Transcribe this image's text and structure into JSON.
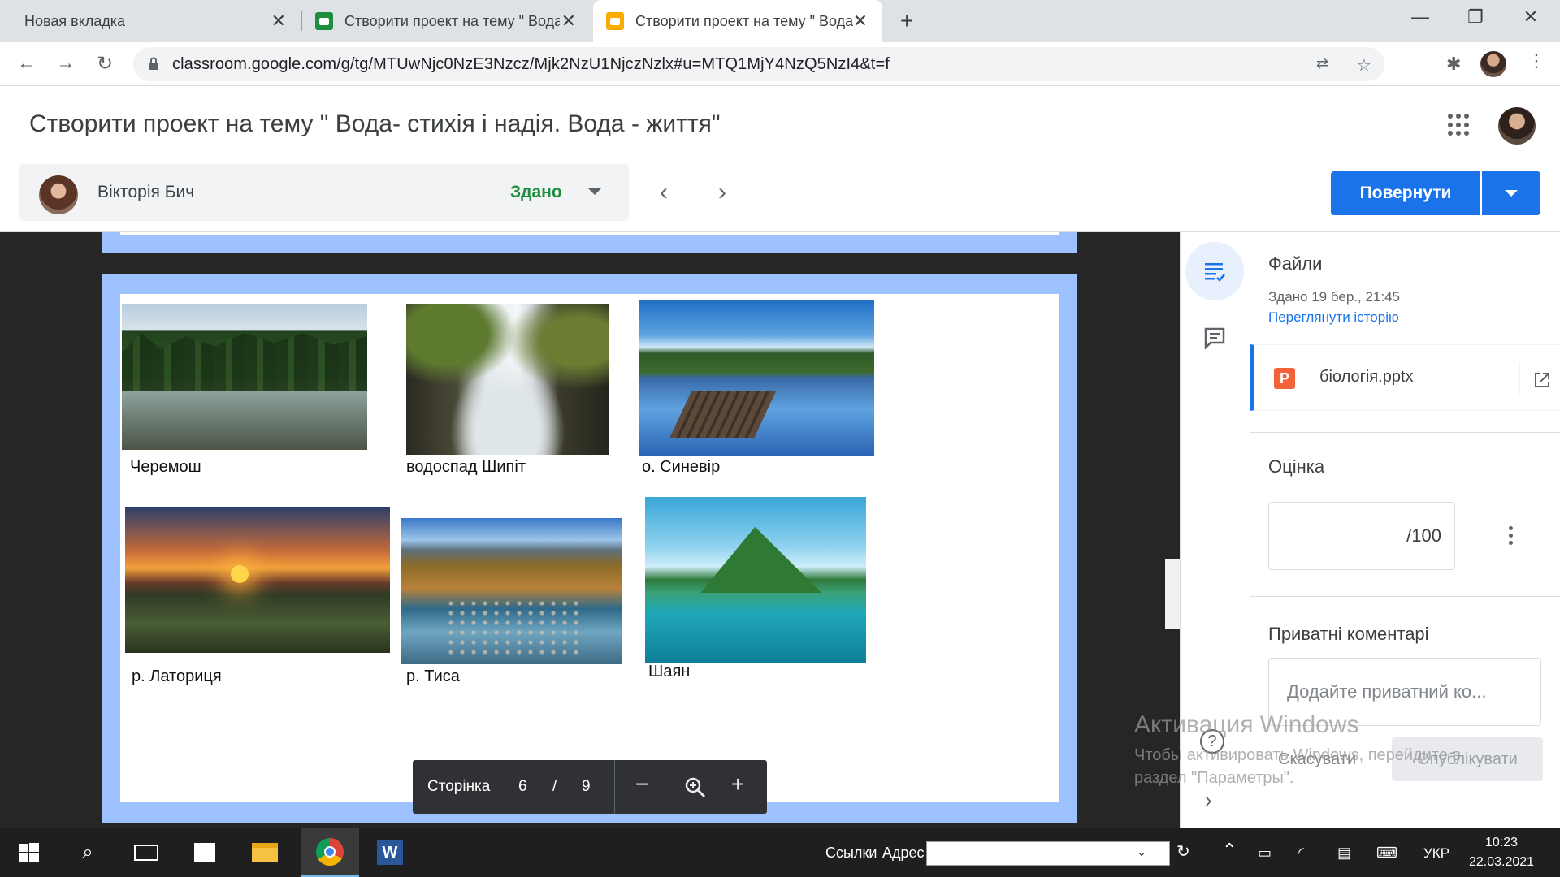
{
  "browser": {
    "tabs": [
      {
        "title": "Новая вкладка"
      },
      {
        "title": "Створити проект на тему \" Вода"
      },
      {
        "title": "Створити проект на тему \" Вода"
      }
    ],
    "url": "classroom.google.com/g/tg/MTUwNjc0NzE3Nzcz/Mjk2NzU1NjczNzlx#u=MTQ1MjY4NzQ5NzI4&t=f"
  },
  "header": {
    "title": "Створити проект на тему \" Вода- стихія і надія. Вода - життя\"",
    "student_name": "Вікторія Бич",
    "status": "Здано",
    "return_label": "Повернути"
  },
  "slide": {
    "photos": [
      {
        "caption": "Черемош"
      },
      {
        "caption": "водоспад Шипіт"
      },
      {
        "caption": "о. Синевір"
      },
      {
        "caption": "р. Латориця"
      },
      {
        "caption": "р. Тиса"
      },
      {
        "caption": "Шаян"
      }
    ]
  },
  "pager": {
    "label": "Сторінка",
    "current": "6",
    "slash": "/",
    "total": "9"
  },
  "side": {
    "files_title": "Файли",
    "submitted": "Здано 19 бер., 21:45",
    "history_link": "Переглянути історію",
    "file_name": "біологія.pptx",
    "file_icon_letter": "P",
    "grade_title": "Оцінка",
    "grade_suffix": "/100",
    "comments_title": "Приватні коментарі",
    "comment_placeholder": "Додайте приватний ко...",
    "cancel": "Скасувати",
    "publish": "Опублікувати"
  },
  "watermark": {
    "line1": "Активация Windows",
    "line2": "Чтобы активировать Windows, перейдите в",
    "line3": "раздел \"Параметры\"."
  },
  "taskbar": {
    "links": "Ссылки",
    "address": "Адрес",
    "lang": "УКР",
    "time": "10:23",
    "date": "22.03.2021"
  },
  "colors": {
    "accent": "#1a73e8",
    "status_green": "#1e8e3e",
    "slide_border": "#9ec1ff"
  }
}
